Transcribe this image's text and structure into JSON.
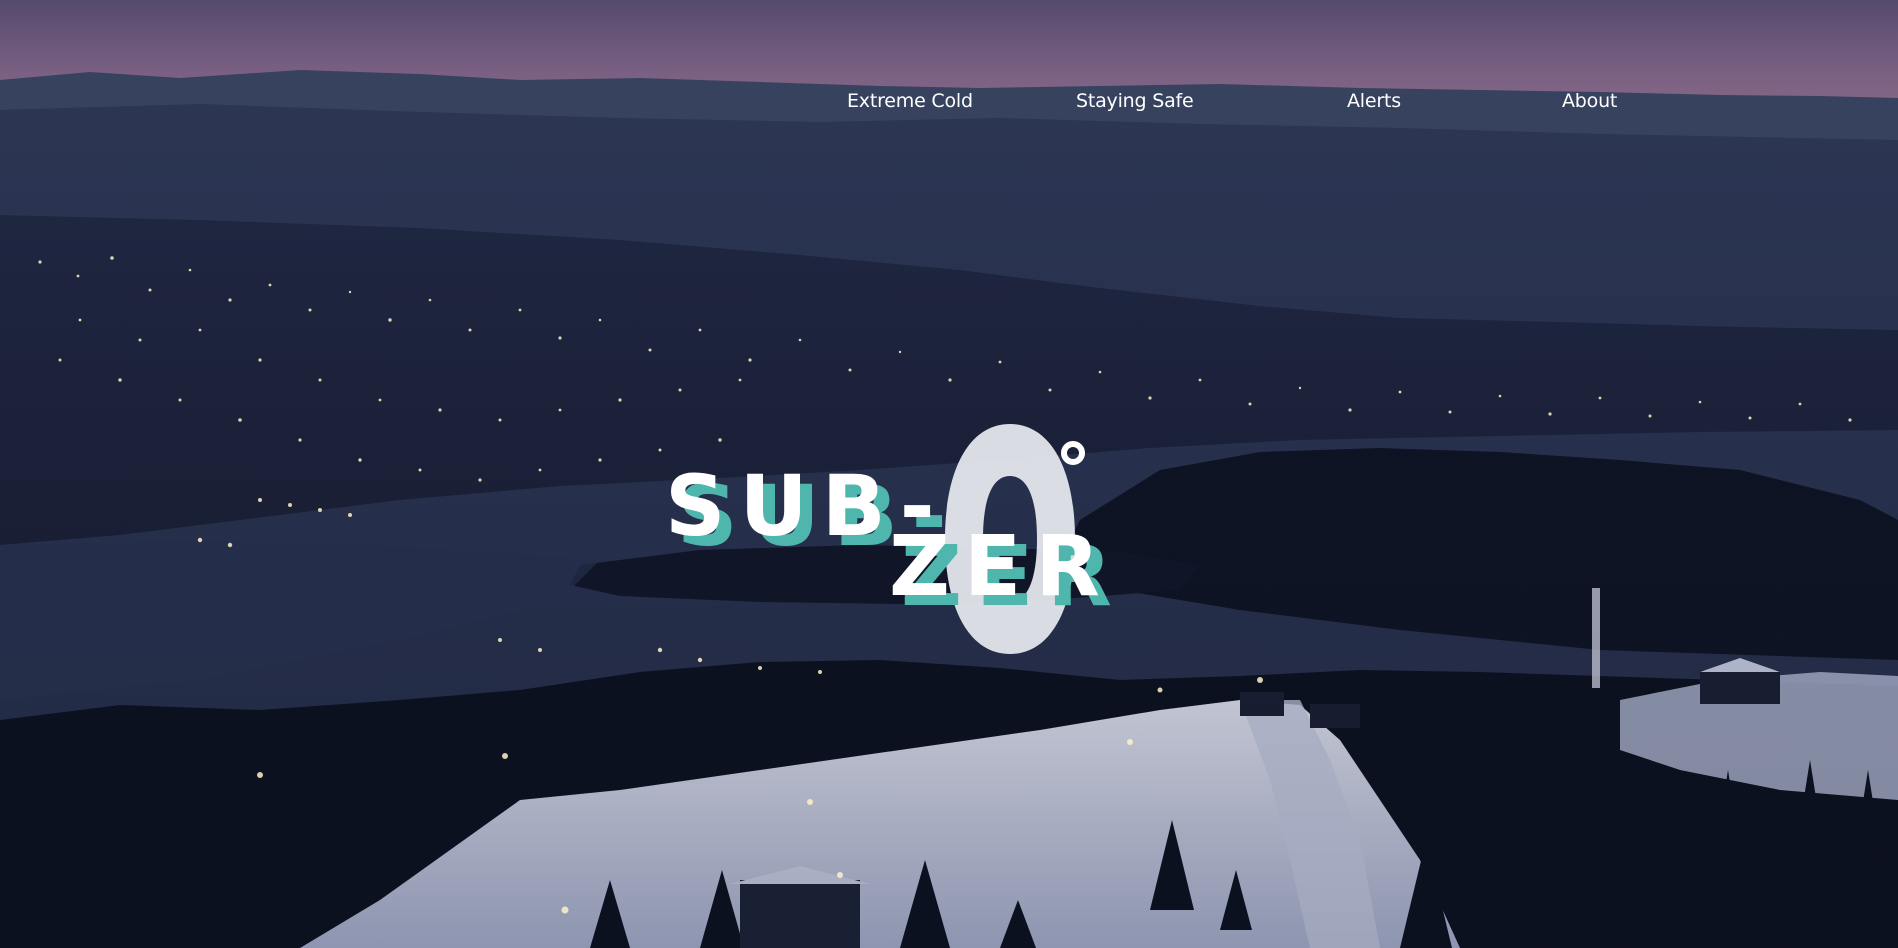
{
  "nav": {
    "items": [
      {
        "label": "Extreme Cold"
      },
      {
        "label": "Staying Safe"
      },
      {
        "label": "Alerts"
      },
      {
        "label": "About"
      }
    ]
  },
  "logo": {
    "line1": "SUB-",
    "line2": "ZER",
    "zero_color": "#e4e7ec",
    "shadow_color": "#4fb6ad"
  },
  "colors": {
    "sky_top": "#6a5a7e",
    "sky_horizon": "#b07fa0",
    "water": "#2c3756",
    "land_dark": "#161c30",
    "snow": "#dfe3f2",
    "city_lights": "#fff2c8"
  }
}
